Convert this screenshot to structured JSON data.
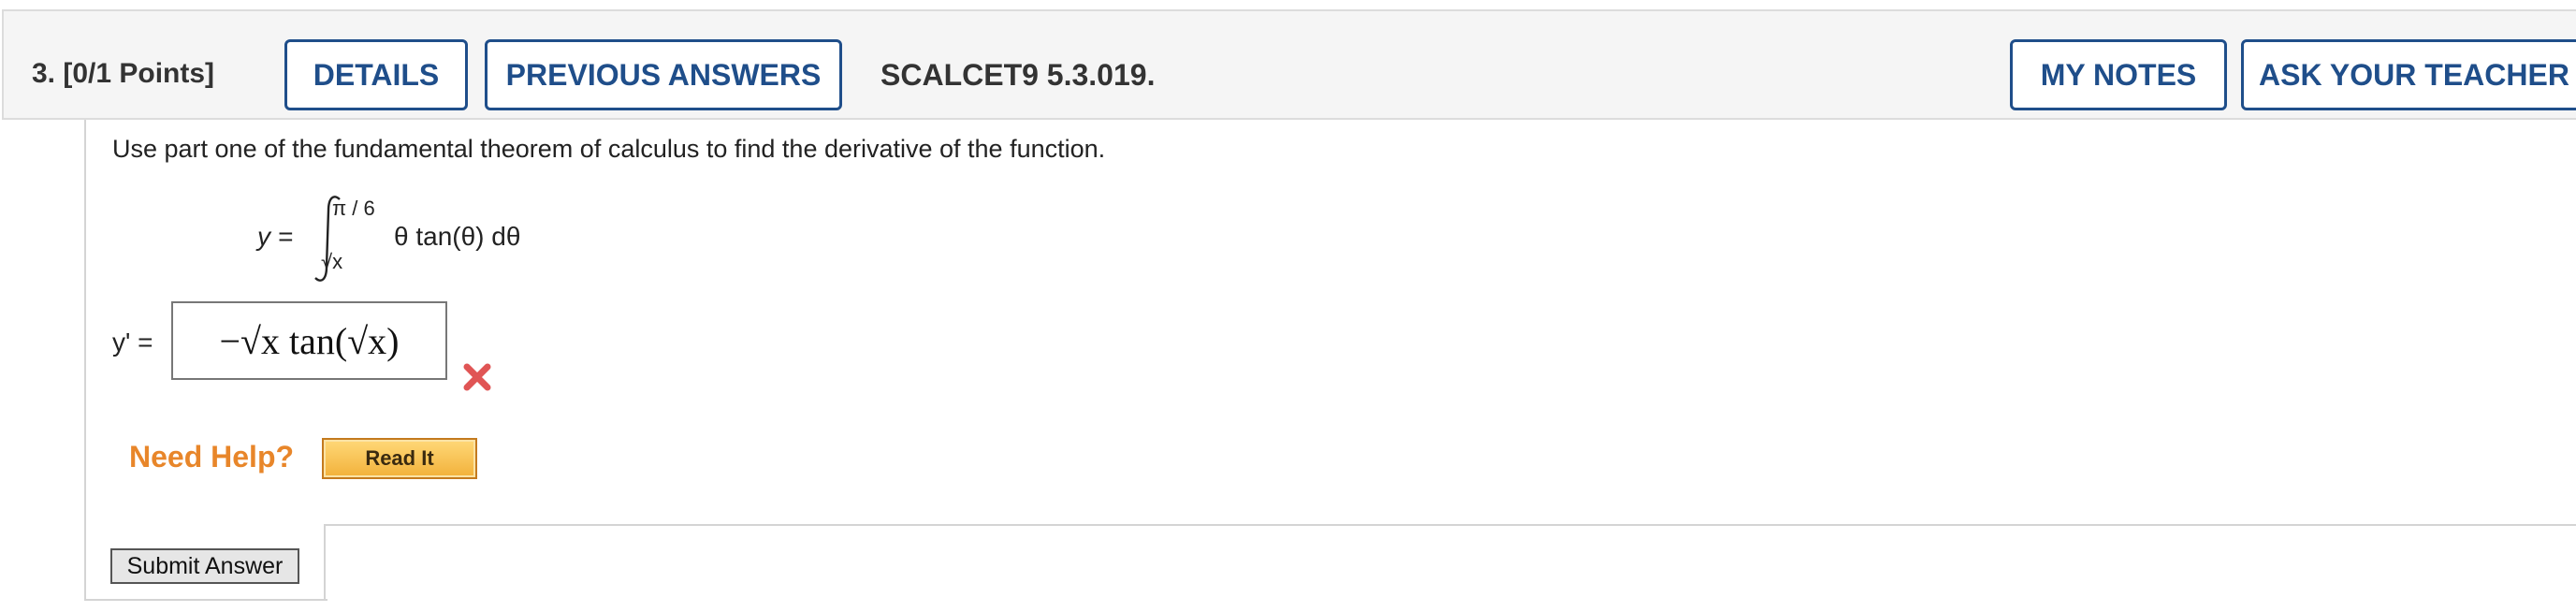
{
  "header": {
    "question_number": "3.  [0/1 Points]",
    "details_label": "DETAILS",
    "previous_answers_label": "PREVIOUS ANSWERS",
    "problem_code": "SCALCET9 5.3.019.",
    "my_notes_label": "MY NOTES",
    "ask_teacher_label": "ASK YOUR TEACHER"
  },
  "question": {
    "prompt": "Use part one of the fundamental theorem of calculus to find the derivative of the function.",
    "function_lhs": "y =",
    "upper_limit": "π / 6",
    "lower_limit": "√x",
    "integrand": "θ tan(θ) dθ",
    "answer_label": "y' =",
    "answer_value": "−√x tan(√x)",
    "answer_status": "incorrect"
  },
  "help": {
    "need_help_label": "Need Help?",
    "read_it_label": "Read It"
  },
  "actions": {
    "submit_label": "Submit Answer"
  },
  "colors": {
    "accent_blue": "#1f4e8a",
    "help_orange": "#e8862a",
    "wrong_red": "#e05555"
  }
}
